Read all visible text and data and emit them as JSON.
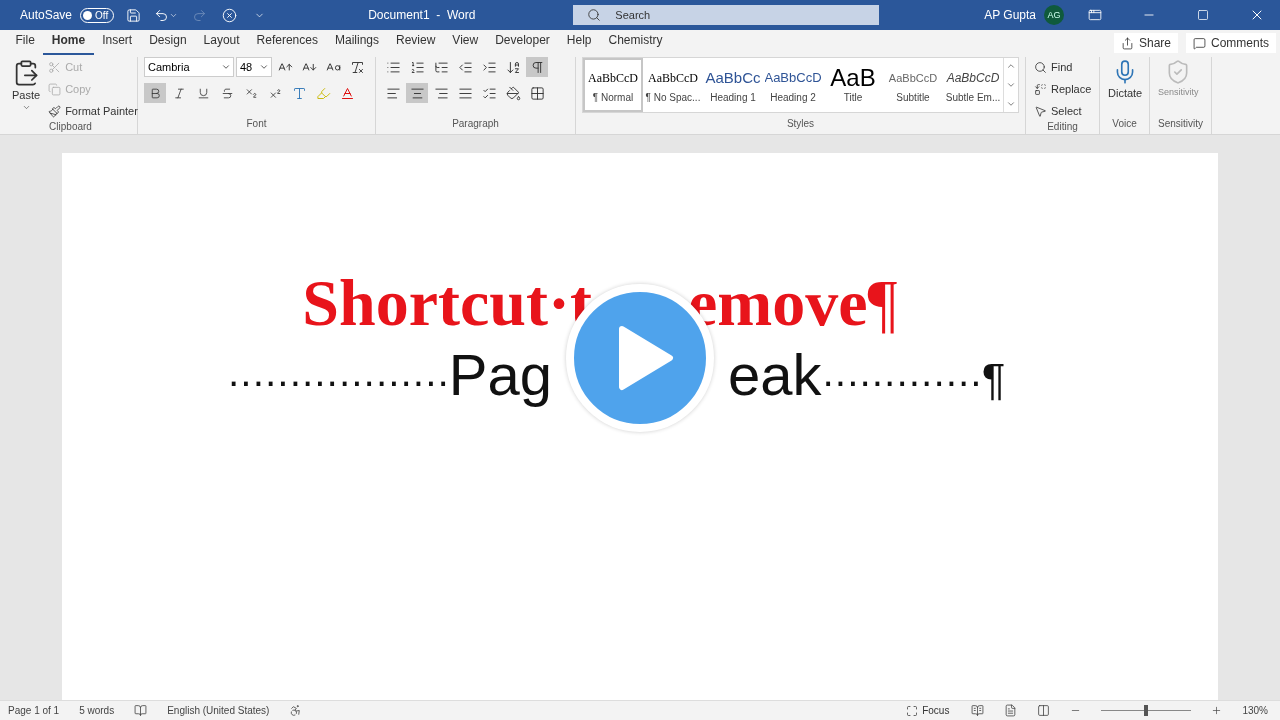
{
  "title_bar": {
    "autosave_label": "AutoSave",
    "autosave_toggle": {
      "label": "Off",
      "on": false
    },
    "document_title": "Document1  -  Word",
    "search": {
      "placeholder": "Search"
    },
    "user_name": "AP Gupta",
    "avatar": "AG"
  },
  "menu_tabs": [
    {
      "label": "File",
      "selected": false
    },
    {
      "label": "Home",
      "selected": true
    },
    {
      "label": "Insert",
      "selected": false
    },
    {
      "label": "Design",
      "selected": false
    },
    {
      "label": "Layout",
      "selected": false
    },
    {
      "label": "References",
      "selected": false
    },
    {
      "label": "Mailings",
      "selected": false
    },
    {
      "label": "Review",
      "selected": false
    },
    {
      "label": "View",
      "selected": false
    },
    {
      "label": "Developer",
      "selected": false
    },
    {
      "label": "Help",
      "selected": false
    },
    {
      "label": "Chemistry",
      "selected": false
    }
  ],
  "share_button": "Share",
  "comments_button": "Comments",
  "clipboard": {
    "label": "Clipboard",
    "paste": "Paste",
    "actions": [
      {
        "kind": "cut",
        "label": "Cut",
        "disabled": true
      },
      {
        "kind": "copy",
        "label": "Copy",
        "disabled": true
      },
      {
        "kind": "painter",
        "label": "Format Painter",
        "disabled": false
      }
    ]
  },
  "font": {
    "label": "Font",
    "font_name": "Cambria",
    "font_size": "48",
    "format_buttons": [
      {
        "kind": "bold",
        "selected": true
      },
      {
        "kind": "italic",
        "selected": false
      },
      {
        "kind": "underline",
        "selected": false
      },
      {
        "kind": "strike",
        "selected": false
      },
      {
        "kind": "subscript",
        "selected": false
      },
      {
        "kind": "superscript",
        "selected": false
      }
    ]
  },
  "paragraph": {
    "label": "Paragraph",
    "show_marks": {
      "selected": true
    },
    "alignments": [
      {
        "kind": "left",
        "selected": false
      },
      {
        "kind": "center",
        "selected": true
      },
      {
        "kind": "right",
        "selected": false
      },
      {
        "kind": "justify",
        "selected": false
      }
    ]
  },
  "styles": {
    "label": "Styles",
    "items": [
      {
        "kind": "normal",
        "preview": "AaBbCcD",
        "name": "¶ Normal",
        "selected": true
      },
      {
        "kind": "no_spacing",
        "preview": "AaBbCcD",
        "name": "¶ No Spac...",
        "selected": false
      },
      {
        "kind": "heading1",
        "preview": "AaBbCc",
        "name": "Heading 1",
        "selected": false
      },
      {
        "kind": "heading2",
        "preview": "AaBbCcD",
        "name": "Heading 2",
        "selected": false
      },
      {
        "kind": "title",
        "preview": "AaB",
        "name": "Title",
        "selected": false
      },
      {
        "kind": "subtitle",
        "preview": "AaBbCcD",
        "name": "Subtitle",
        "selected": false
      },
      {
        "kind": "subtle_emphasis",
        "preview": "AaBbCcD",
        "name": "Subtle Em...",
        "selected": false
      }
    ]
  },
  "editing": {
    "label": "Editing",
    "actions": [
      {
        "kind": "find",
        "label": "Find"
      },
      {
        "kind": "replace",
        "label": "Replace"
      },
      {
        "kind": "select",
        "label": "Select"
      }
    ]
  },
  "voice": {
    "label": "Voice",
    "dictate": "Dictate"
  },
  "sensitivity": {
    "label": "Sensitivity",
    "button": {
      "label": "Sensitivity",
      "disabled": true
    }
  },
  "document": {
    "heading": {
      "left": "Shortcut·t",
      "right": "emove"
    },
    "heading_mark": "¶",
    "break_line": {
      "leading_dots": "··················",
      "text_left": "Pag",
      "text_right": "eak",
      "trailing_dots": "·············",
      "mark": "¶"
    }
  },
  "status_bar": {
    "page": "Page 1 of 1",
    "words": "5 words",
    "language": "English (United States)",
    "focus": "Focus",
    "zoom": {
      "level": 0.5
    },
    "zoom_label": "130%"
  }
}
